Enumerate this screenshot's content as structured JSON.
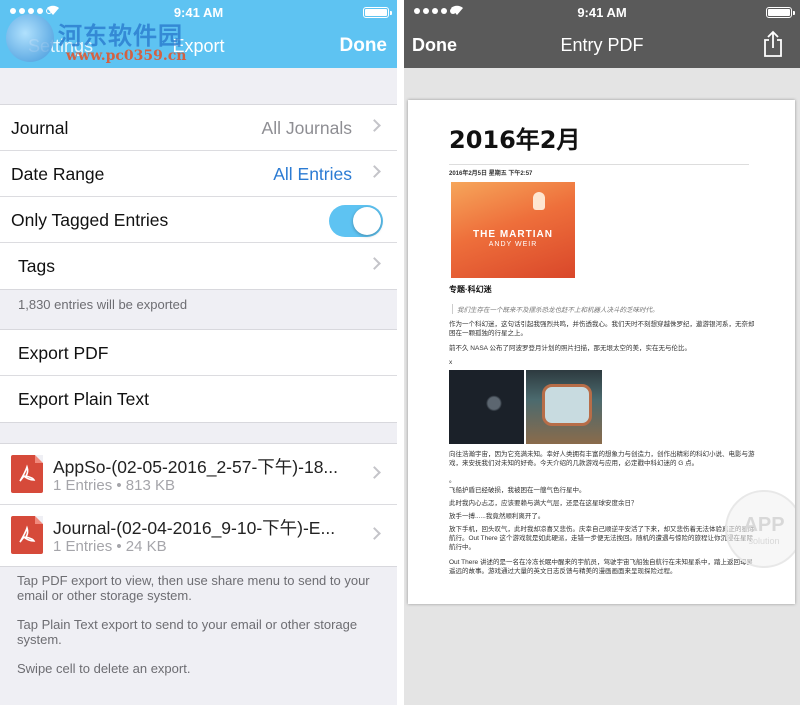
{
  "status": {
    "time": "9:41 AM"
  },
  "watermark": {
    "text": "河东软件园",
    "url": "www.pc0359.cn"
  },
  "left": {
    "nav": {
      "back": "Settings",
      "title": "Export",
      "done": "Done"
    },
    "settings": [
      {
        "label": "Journal",
        "value": "All Journals"
      },
      {
        "label": "Date Range",
        "value": "All Entries"
      },
      {
        "label": "Only Tagged Entries",
        "toggle": true
      },
      {
        "label": "Tags"
      }
    ],
    "count_note": "1,830 entries will be exported",
    "actions": [
      "Export PDF",
      "Export Plain Text"
    ],
    "files": [
      {
        "name": "AppSo-(02-05-2016_2-57-下午)-18...",
        "meta": "1 Entries • 813 KB"
      },
      {
        "name": "Journal-(02-04-2016_9-10-下午)-E...",
        "meta": "1 Entries • 24 KB"
      }
    ],
    "help": [
      "Tap PDF export to view, then use share menu to send to your email or other storage system.",
      "Tap Plain Text export to send to your email or other storage system.",
      "Swipe cell to delete an export."
    ]
  },
  "right": {
    "nav": {
      "done": "Done",
      "title": "Entry PDF"
    },
    "page": {
      "title": "2016年2月",
      "date": "2016年2月5日 星期五 下午2:57",
      "hero_title": "THE MARTIAN",
      "hero_author": "ANDY WEIR",
      "section": "专题·科幻迷",
      "quote": "我们生存在一个既来不及摆杀恐龙也赶不上和机器人决斗的乏味时代。",
      "para1": "作为一个科幻迷，这句话引起我强烈共鸣，并伤透我心。我们天时不刻想穿越侏罗纪，遨游银河系，无奈却困在一颗孤独的行星之上。",
      "para2": "前不久 NASA 公布了阿波罗登月计划的照片扫描，那无垠太空的美，实在无与伦比。",
      "para_x": "x",
      "para3": "向往浩瀚宇宙，因为它充满未知。幸好人类拥有丰富的想象力与创造力，创作出精彩的科幻小说、电影与游戏，来安抚我们对未知的好奇。今天介绍的几款游戏与应用，必定戳中科幻迷的 G 点。",
      "para_dot": "。",
      "para4": "飞船护盾已经破损，我被困在一艘气色行星中。",
      "para5": "此时我内心忐忑，应该要赖与满大气层，还是在这星球安度余日？",
      "para6": "放手一搏......我竟然顺利离开了。",
      "para7": "放下手机，回头叹气，此时我却凉喜又悲伤。庆幸自己顺逆平安活了下来，却又悲伤着无法体验真正的星际航行。Out There 这个游戏就是如此硬派，走错一步便无法挽回。随机的遭遇与惊险的旅程让你沉浸在星际航行中。",
      "para8": "Out There 讲述的是一名在冷冻长眠中醒来的宇航员，驾驶宇宙飞船独自航行在未知星系中，踏上返回母星遥远的故事。游戏通过大量的英文日志反馈与精美的漫画画面来呈现探险过程。",
      "stamp": "APP",
      "stamp_sub": "solution"
    }
  },
  "colors": {
    "left_nav": "#5ec3f2",
    "right_nav": "#5a5a5a",
    "pdf_red": "#d64a3a",
    "toggle_on": "#5ec3f2",
    "link_blue": "#2b7bd3"
  }
}
